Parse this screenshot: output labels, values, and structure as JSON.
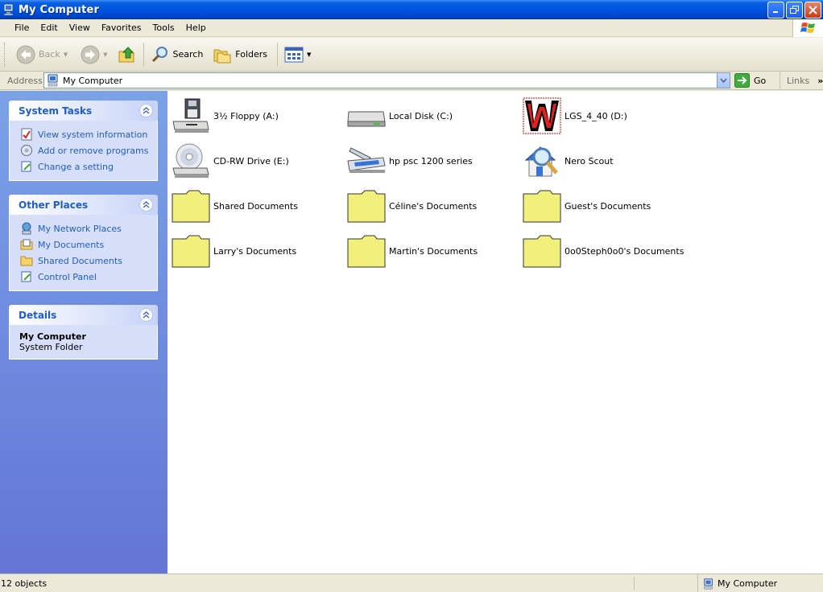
{
  "window": {
    "title": "My Computer"
  },
  "menubar": {
    "items": [
      "File",
      "Edit",
      "View",
      "Favorites",
      "Tools",
      "Help"
    ]
  },
  "toolbar": {
    "back_label": "Back",
    "search_label": "Search",
    "folders_label": "Folders"
  },
  "address": {
    "label": "Address",
    "value": "My Computer",
    "go_label": "Go",
    "links_label": "Links"
  },
  "panels": {
    "system_tasks": {
      "title": "System Tasks",
      "items": [
        "View system information",
        "Add or remove programs",
        "Change a setting"
      ]
    },
    "other_places": {
      "title": "Other Places",
      "items": [
        "My Network Places",
        "My Documents",
        "Shared Documents",
        "Control Panel"
      ]
    },
    "details": {
      "title": "Details",
      "name": "My Computer",
      "type": "System Folder"
    }
  },
  "items": [
    {
      "label": "3½ Floppy (A:)",
      "icon": "floppy-drive-icon"
    },
    {
      "label": "Local Disk (C:)",
      "icon": "hard-disk-icon"
    },
    {
      "label": "LGS_4_40 (D:)",
      "icon": "custom-w-drive-icon"
    },
    {
      "label": "CD-RW Drive (E:)",
      "icon": "cd-drive-icon"
    },
    {
      "label": "hp psc 1200 series",
      "icon": "scanner-icon"
    },
    {
      "label": "Nero Scout",
      "icon": "nero-scout-icon"
    },
    {
      "label": "Shared Documents",
      "icon": "folder-icon"
    },
    {
      "label": "Céline's Documents",
      "icon": "folder-icon"
    },
    {
      "label": "Guest's Documents",
      "icon": "folder-icon"
    },
    {
      "label": "Larry's Documents",
      "icon": "folder-icon"
    },
    {
      "label": "Martin's Documents",
      "icon": "folder-icon"
    },
    {
      "label": "0o0Steph0o0's Documents",
      "icon": "folder-icon"
    }
  ],
  "status": {
    "count": "12 objects",
    "location": "My Computer"
  },
  "colors": {
    "titlebar": "#0055e5",
    "link": "#215dc6",
    "folder": "#f1f07a",
    "sidebar": "#7ba2e7"
  }
}
